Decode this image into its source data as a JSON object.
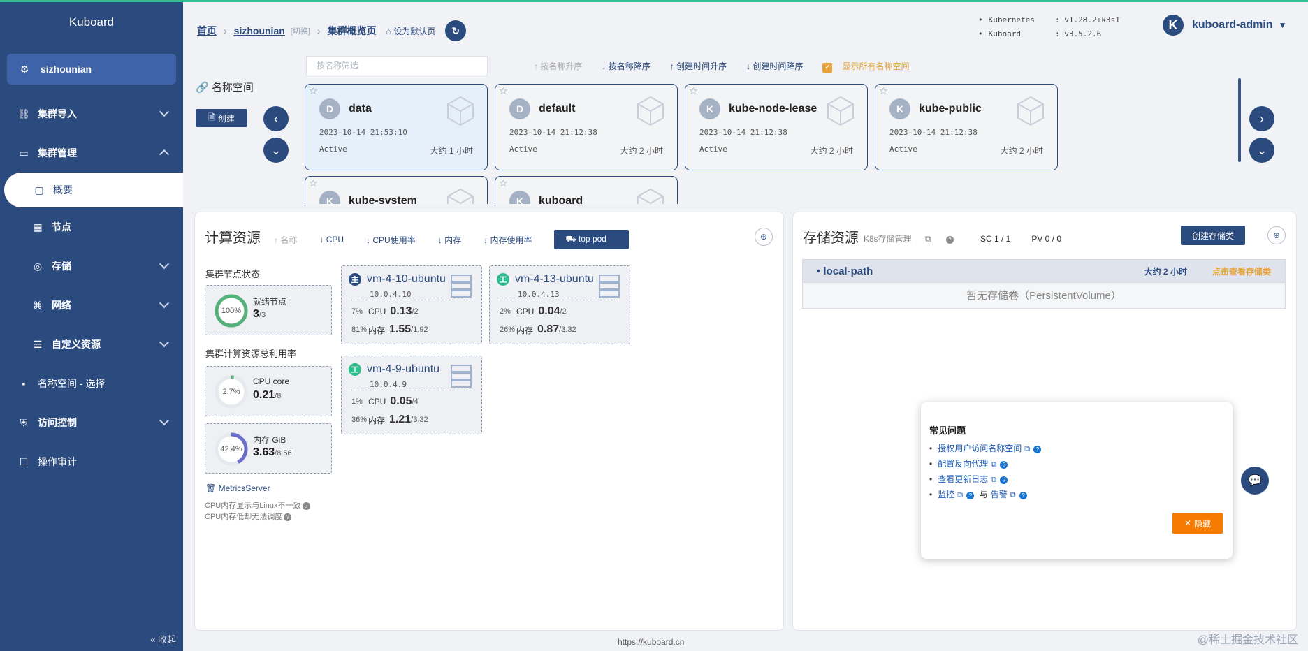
{
  "sidebar": {
    "brand": "Kuboard",
    "cluster": "sizhounian",
    "items": [
      {
        "label": "集群导入",
        "icon": "link-icon"
      },
      {
        "label": "集群管理",
        "icon": "cabinet-icon"
      },
      {
        "label": "概要",
        "icon": "board-icon"
      },
      {
        "label": "节点",
        "icon": "grid-icon"
      },
      {
        "label": "存储",
        "icon": "database-icon"
      },
      {
        "label": "网络",
        "icon": "network-icon"
      },
      {
        "label": "自定义资源",
        "icon": "sliders-icon"
      },
      {
        "label": "名称空间 - 选择",
        "icon": "apps-icon"
      },
      {
        "label": "访问控制",
        "icon": "lock-icon"
      },
      {
        "label": "操作审计",
        "icon": "audit-icon"
      }
    ],
    "collapse": "收起"
  },
  "header": {
    "breadcrumb": [
      "首页",
      "sizhounian",
      "集群概览页"
    ],
    "switch": "[切换]",
    "set_default": "设为默认页",
    "versions": [
      {
        "k": "Kubernetes",
        "v": ":  v1.28.2+k3s1"
      },
      {
        "k": "Kuboard",
        "v": ":  v3.5.2.6"
      }
    ],
    "user": "kuboard-admin",
    "user_initial": "K"
  },
  "namespaces": {
    "label": "名称空间",
    "create": "创建",
    "filter_placeholder": "按名称筛选",
    "sorts": [
      "按名称升序",
      "按名称降序",
      "创建时间升序",
      "创建时间降序"
    ],
    "show_all": "显示所有名称空间",
    "items": [
      {
        "initial": "D",
        "name": "data",
        "date": "2023-10-14 21:53:10",
        "status": "Active",
        "age": "大约 1 小时"
      },
      {
        "initial": "D",
        "name": "default",
        "date": "2023-10-14 21:12:38",
        "status": "Active",
        "age": "大约 2 小时"
      },
      {
        "initial": "K",
        "name": "kube-node-lease",
        "date": "2023-10-14 21:12:38",
        "status": "Active",
        "age": "大约 2 小时"
      },
      {
        "initial": "K",
        "name": "kube-public",
        "date": "2023-10-14 21:12:38",
        "status": "Active",
        "age": "大约 2 小时"
      },
      {
        "initial": "K",
        "name": "kube-system",
        "date": "",
        "status": "",
        "age": ""
      },
      {
        "initial": "K",
        "name": "kuboard",
        "date": "",
        "status": "",
        "age": ""
      }
    ]
  },
  "compute": {
    "title": "计算资源",
    "toolbar": [
      "名称",
      "CPU",
      "CPU使用率",
      "内存",
      "内存使用率"
    ],
    "top_pod": "top pod",
    "node_status_title": "集群节点状态",
    "ready": {
      "pct": "100%",
      "label": "就绪节点",
      "value": "3",
      "total": "/3"
    },
    "usage_title": "集群计算资源总利用率",
    "cpu": {
      "pct": "2.7%",
      "label": "CPU core",
      "value": "0.21",
      "total": "/8"
    },
    "mem": {
      "pct": "42.4%",
      "label": "内存 GiB",
      "value": "3.63",
      "total": "/8.56"
    },
    "nodes": [
      {
        "badge": "主",
        "name": "vm-4-10-ubuntu",
        "ip": "10.0.4.10",
        "cpu_pct": "7%",
        "cpu": "0.13",
        "cpu_total": "/2",
        "mem_pct": "81%",
        "mem": "1.55",
        "mem_total": "/1.92"
      },
      {
        "badge": "工",
        "name": "vm-4-13-ubuntu",
        "ip": "10.0.4.13",
        "cpu_pct": "2%",
        "cpu": "0.04",
        "cpu_total": "/2",
        "mem_pct": "26%",
        "mem": "0.87",
        "mem_total": "/3.32"
      },
      {
        "badge": "工",
        "name": "vm-4-9-ubuntu",
        "ip": "10.0.4.9",
        "cpu_pct": "1%",
        "cpu": "0.05",
        "cpu_total": "/4",
        "mem_pct": "36%",
        "mem": "1.21",
        "mem_total": "/3.32"
      }
    ],
    "metrics": "MetricsServer",
    "notes": [
      "CPU内存显示与Linux不一致",
      "CPU内存低却无法调度"
    ],
    "cpu_label": "CPU",
    "mem_label": "内存"
  },
  "storage": {
    "title": "存储资源",
    "k8s": "K8s存储管理",
    "sc": "SC 1 / 1",
    "pv": "PV 0 / 0",
    "create": "创建存储类",
    "class_name": "local-path",
    "class_age": "大约 2 小时",
    "class_link": "点击查看存储类",
    "empty": "暂无存储卷（PersistentVolume）"
  },
  "faq": {
    "title": "常见问题",
    "items": [
      "授权用户访问名称空间",
      "配置反向代理",
      "查看更新日志",
      "监控"
    ],
    "and": "与",
    "alert": "告警",
    "hide": "隐藏"
  },
  "footer": {
    "url": "https://kuboard.cn",
    "watermark": "@稀土掘金技术社区"
  },
  "colors": {
    "primary": "#2b4a7e",
    "accent": "#e6a23c",
    "success": "#2fbf8f",
    "faq_button": "#f57c00"
  }
}
